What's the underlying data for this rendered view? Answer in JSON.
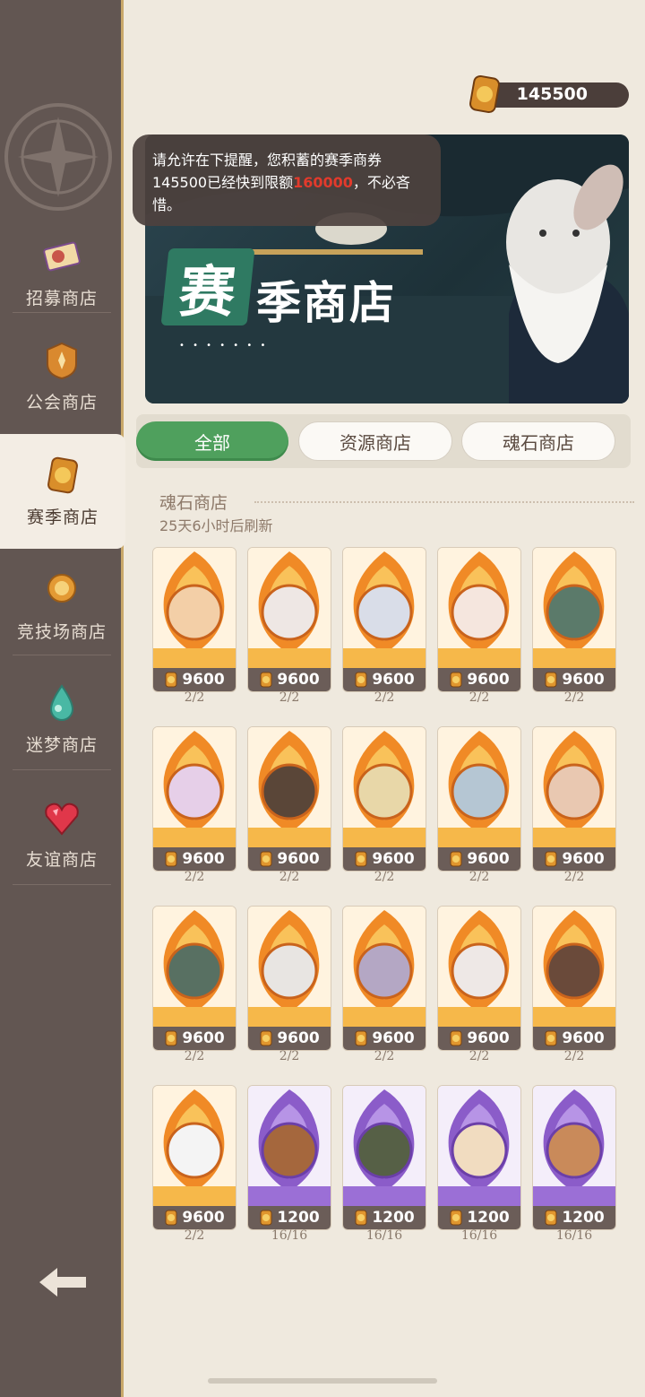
{
  "currency": {
    "amount": "145500",
    "icon": "season-coin-icon"
  },
  "tooltip": {
    "line1": "请允许在下提醒，您积蓄的赛季商券",
    "amount": "145500",
    "mid": "已经快到限额",
    "limit": "160000",
    "tail": "，不必吝惜。"
  },
  "banner": {
    "logo_char": "赛",
    "logo_rest": "季商店",
    "dots": "• • • • • • •"
  },
  "sidebar": {
    "items": [
      {
        "label": "招募商店",
        "icon": "recruit-ticket-icon"
      },
      {
        "label": "公会商店",
        "icon": "guild-crest-icon"
      },
      {
        "label": "赛季商店",
        "icon": "season-coin-icon",
        "active": true
      },
      {
        "label": "竞技场商店",
        "icon": "arena-medal-icon"
      },
      {
        "label": "迷梦商店",
        "icon": "dream-drop-icon"
      },
      {
        "label": "友谊商店",
        "icon": "heart-gem-icon"
      }
    ],
    "back_icon": "back-arrow-icon"
  },
  "tabs": [
    "全部",
    "资源商店",
    "魂石商店"
  ],
  "section": {
    "title": "魂石商店",
    "refresh": "25天6小时后刷新"
  },
  "cards": [
    {
      "price": "9600",
      "stock": "2/2",
      "type": "fire"
    },
    {
      "price": "9600",
      "stock": "2/2",
      "type": "fire"
    },
    {
      "price": "9600",
      "stock": "2/2",
      "type": "fire"
    },
    {
      "price": "9600",
      "stock": "2/2",
      "type": "fire"
    },
    {
      "price": "9600",
      "stock": "2/2",
      "type": "fire"
    },
    {
      "price": "9600",
      "stock": "2/2",
      "type": "fire"
    },
    {
      "price": "9600",
      "stock": "2/2",
      "type": "fire"
    },
    {
      "price": "9600",
      "stock": "2/2",
      "type": "fire"
    },
    {
      "price": "9600",
      "stock": "2/2",
      "type": "fire"
    },
    {
      "price": "9600",
      "stock": "2/2",
      "type": "fire"
    },
    {
      "price": "9600",
      "stock": "2/2",
      "type": "fire"
    },
    {
      "price": "9600",
      "stock": "2/2",
      "type": "fire"
    },
    {
      "price": "9600",
      "stock": "2/2",
      "type": "fire"
    },
    {
      "price": "9600",
      "stock": "2/2",
      "type": "fire"
    },
    {
      "price": "9600",
      "stock": "2/2",
      "type": "fire"
    },
    {
      "price": "9600",
      "stock": "2/2",
      "type": "fire"
    },
    {
      "price": "1200",
      "stock": "16/16",
      "type": "purple"
    },
    {
      "price": "1200",
      "stock": "16/16",
      "type": "purple"
    },
    {
      "price": "1200",
      "stock": "16/16",
      "type": "purple"
    },
    {
      "price": "1200",
      "stock": "16/16",
      "type": "purple"
    }
  ],
  "colors": {
    "accent_green": "#4fa05d",
    "sidebar": "#625652",
    "limit_red": "#e23a2c"
  }
}
